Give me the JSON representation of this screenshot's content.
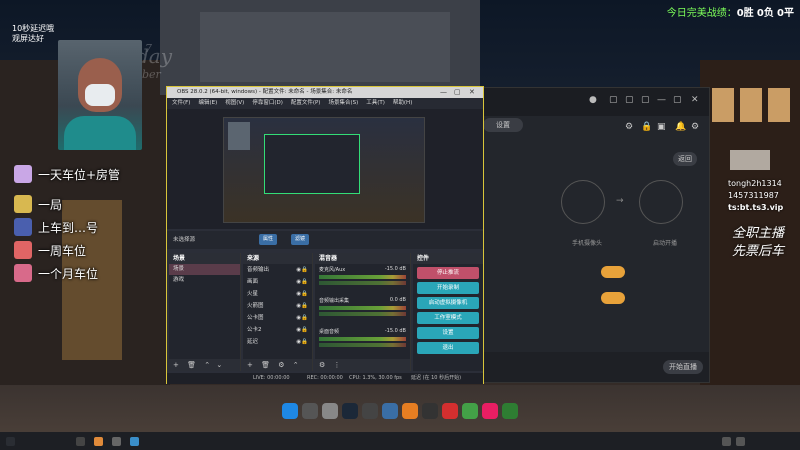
{
  "overlay": {
    "score_text_prefix": "今日完美战绩：",
    "wins": "0胜",
    "losses": "0负",
    "draws": "0平",
    "delay_label_1": "10秒延迟哦",
    "delay_label_2": "观屏达好"
  },
  "background_text": {
    "day": "day",
    "ber": "ber",
    "seven": "7"
  },
  "menu_list": [
    {
      "label": "一天车位+房管",
      "color": "#c9a7e6"
    },
    {
      "label": "一局",
      "color": "#d8b850"
    },
    {
      "label": "上车到…号",
      "color": "#4a5fae"
    },
    {
      "label": "一周车位",
      "color": "#e06565"
    },
    {
      "label": "一个月车位",
      "color": "#d86a8a"
    }
  ],
  "chat_right": {
    "line1": "tongh2h1314",
    "line2": "1457311987",
    "line3": "ts:bt.ts3.vip",
    "big1": "全职主播",
    "big2": "先票后车"
  },
  "obs": {
    "title": "OBS 28.0.2 (64-bit, windows) - 配置文件: 未命名 - 场景集合: 未命名",
    "menu": [
      "文件(F)",
      "编辑(E)",
      "视图(V)",
      "停靠窗口(D)",
      "配置文件(P)",
      "场景集合(S)",
      "工具(T)",
      "帮助(H)"
    ],
    "no_source_label": "未选择源",
    "btn_properties": "属性",
    "btn_filters": "滤镜",
    "docks": {
      "scenes": {
        "title": "场景",
        "items": [
          "场景",
          "游戏"
        ]
      },
      "sources": {
        "title": "来源",
        "items": [
          "音频输出",
          "画面",
          "火星",
          "火箭图",
          "公卡图",
          "公卡2",
          "延迟"
        ]
      },
      "mixer": {
        "title": "混音器",
        "items": [
          {
            "name": "麦克风/Aux",
            "db": "-15.0 dB"
          },
          {
            "name": "音频输出采集",
            "db": "0.0 dB"
          },
          {
            "name": "桌面音频",
            "db": "-15.0 dB"
          }
        ]
      },
      "controls": {
        "title": "控件",
        "buttons": [
          "停止推流",
          "开始录制",
          "启动虚拟摄像机",
          "工作室模式",
          "设置",
          "退出"
        ]
      }
    },
    "status": {
      "live": "LIVE: 00:00:00",
      "rec": "REC: 00:00:00",
      "cpu": "CPU: 1.3%, 30.00 fps",
      "delay": "延迟 (在 10 秒后开始)"
    }
  },
  "right_app": {
    "top_label": "设置",
    "pill_back": "返回",
    "step3_label": "手机摄像头",
    "step4_label": "启动开播",
    "bottom_btn": "开始直播",
    "arrow": "→"
  },
  "dock_apps": [
    {
      "name": "windows-icon",
      "color": "#1e88e5"
    },
    {
      "name": "browser-icon",
      "color": "#555"
    },
    {
      "name": "chrome-icon",
      "color": "#888"
    },
    {
      "name": "steam-icon",
      "color": "#1b2838"
    },
    {
      "name": "cloud-icon",
      "color": "#444"
    },
    {
      "name": "shield-icon",
      "color": "#3a6ea5"
    },
    {
      "name": "fire-icon",
      "color": "#e67e22"
    },
    {
      "name": "disc-icon",
      "color": "#333"
    },
    {
      "name": "netease-icon",
      "color": "#d32f2f"
    },
    {
      "name": "iqiyi-icon",
      "color": "#43a047"
    },
    {
      "name": "pink-app-icon",
      "color": "#e91e63"
    },
    {
      "name": "wechat-icon",
      "color": "#2e7d32"
    }
  ],
  "colors": {
    "accent_score": "#7dff5a",
    "obs_border": "#d8c53a",
    "obs_control_btn": "#2aa6b8",
    "obs_stop_btn": "#c0506a",
    "orange_toggle": "#e8a23a"
  }
}
